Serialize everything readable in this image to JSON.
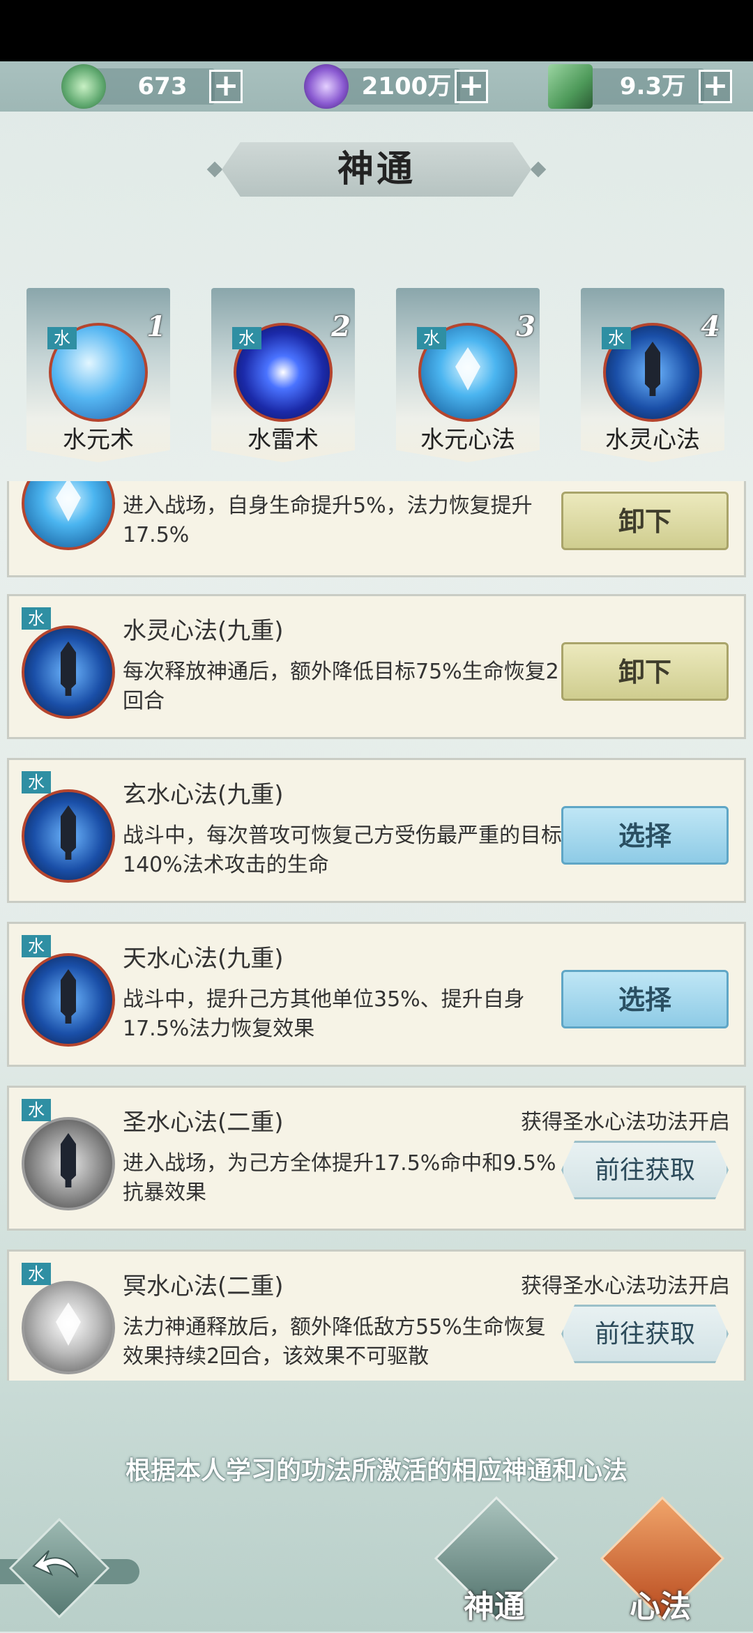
{
  "currencies": [
    {
      "name": "jade",
      "value": "673",
      "icon": "jade-coin-icon",
      "color": "#5fa86f"
    },
    {
      "name": "spirit",
      "value": "2100万",
      "icon": "purple-spirit-icon",
      "color": "#8a5ad1"
    },
    {
      "name": "scroll",
      "value": "9.3万",
      "icon": "green-scroll-icon",
      "color": "#4e9a5a"
    }
  ],
  "page_title": "神通",
  "tabs": [
    {
      "number": "1",
      "element": "水",
      "label": "水元术",
      "art": "wave"
    },
    {
      "number": "2",
      "element": "水",
      "label": "水雷术",
      "art": "orb"
    },
    {
      "number": "3",
      "element": "水",
      "label": "水元心法",
      "art": "crystal"
    },
    {
      "number": "4",
      "element": "水",
      "label": "水灵心法",
      "art": "sword"
    }
  ],
  "skills": [
    {
      "element": "水",
      "title": "",
      "desc": "进入战场，自身生命提升5%，法力恢复提升17.5%",
      "requirement": "",
      "button": "卸下",
      "button_type": "unequip",
      "art": "crystal"
    },
    {
      "element": "水",
      "title": "水灵心法(九重)",
      "desc": "每次释放神通后，额外降低目标75%生命恢复2回合",
      "requirement": "",
      "button": "卸下",
      "button_type": "unequip",
      "art": "sword"
    },
    {
      "element": "水",
      "title": "玄水心法(九重)",
      "desc": "战斗中，每次普攻可恢复己方受伤最严重的目标140%法术攻击的生命",
      "requirement": "",
      "button": "选择",
      "button_type": "select",
      "art": "sword"
    },
    {
      "element": "水",
      "title": "天水心法(九重)",
      "desc": "战斗中，提升己方其他单位35%、提升自身17.5%法力恢复效果",
      "requirement": "",
      "button": "选择",
      "button_type": "select",
      "art": "sword"
    },
    {
      "element": "水",
      "title": "圣水心法(二重)",
      "desc": "进入战场，为己方全体提升17.5%命中和9.5%抗暴效果",
      "requirement": "获得圣水心法功法开启",
      "button": "前往获取",
      "button_type": "goto",
      "art": "sword-gray"
    },
    {
      "element": "水",
      "title": "冥水心法(二重)",
      "desc": "法力神通释放后，额外降低敌方55%生命恢复效果持续2回合，该效果不可驱散",
      "requirement": "获得圣水心法功法开启",
      "button": "前往获取",
      "button_type": "goto",
      "art": "crystal-gray"
    }
  ],
  "hint": "根据本人学习的功法所激活的相应神通和心法",
  "bottom_nav": [
    {
      "label": "神通",
      "color": "#6f8f8a"
    },
    {
      "label": "心法",
      "color": "#c4622e"
    }
  ]
}
